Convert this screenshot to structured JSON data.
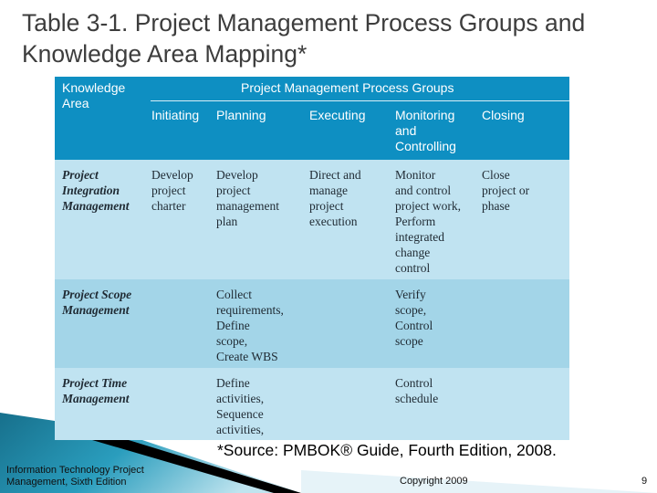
{
  "slide": {
    "title": "Table 3-1. Project Management Process Groups and Knowledge Area Mapping*",
    "source_note": "*Source: PMBOK® Guide, Fourth Edition, 2008.",
    "footer_left": "Information Technology Project Management, Sixth Edition",
    "copyright": "Copyright 2009",
    "page_number": "9"
  },
  "colors": {
    "header_bg": "#0e8fc2",
    "row_light": "#c0e3f1",
    "row_mid": "#a3d5e8",
    "swoosh_teal": "#1f8fae"
  },
  "table": {
    "knowledge_area_header": "Knowledge Area",
    "group_header": "Project Management Process Groups",
    "columns": [
      "Initiating",
      "Planning",
      "Executing",
      "Monitoring and Controlling",
      "Closing"
    ],
    "rows": [
      {
        "area": "Project Integration Management",
        "cells": [
          "Develop project charter",
          "Develop project management plan",
          "Direct and manage project execution",
          "Monitor and control project work, Perform integrated change control",
          "Close project or phase"
        ]
      },
      {
        "area": "Project Scope Management",
        "cells": [
          "",
          "Collect requirements, Define scope, Create WBS",
          "",
          "Verify scope, Control scope",
          ""
        ]
      },
      {
        "area": "Project Time Management",
        "cells": [
          "",
          "Define activities, Sequence activities,",
          "",
          "Control schedule",
          ""
        ]
      }
    ]
  },
  "display_lines": {
    "ka_header": "Knowledge\nArea",
    "mc_header": "Monitoring\nand\nControlling",
    "r1": [
      "Project\nIntegration\nManagement",
      "Develop\nproject\ncharter",
      "Develop\nproject\nmanagement\nplan",
      "Direct and\nmanage\nproject\nexecution",
      "Monitor\nand control\nproject work,\nPerform\nintegrated\nchange\ncontrol",
      "Close\nproject or\nphase"
    ],
    "r2": [
      "Project Scope\nManagement",
      "",
      "Collect\nrequirements,\nDefine\nscope,\nCreate WBS",
      "",
      "Verify\nscope,\nControl\nscope",
      ""
    ],
    "r3": [
      "Project Time\nManagement",
      "",
      "Define\nactivities,\nSequence\nactivities,",
      "",
      "Control\nschedule",
      ""
    ]
  }
}
